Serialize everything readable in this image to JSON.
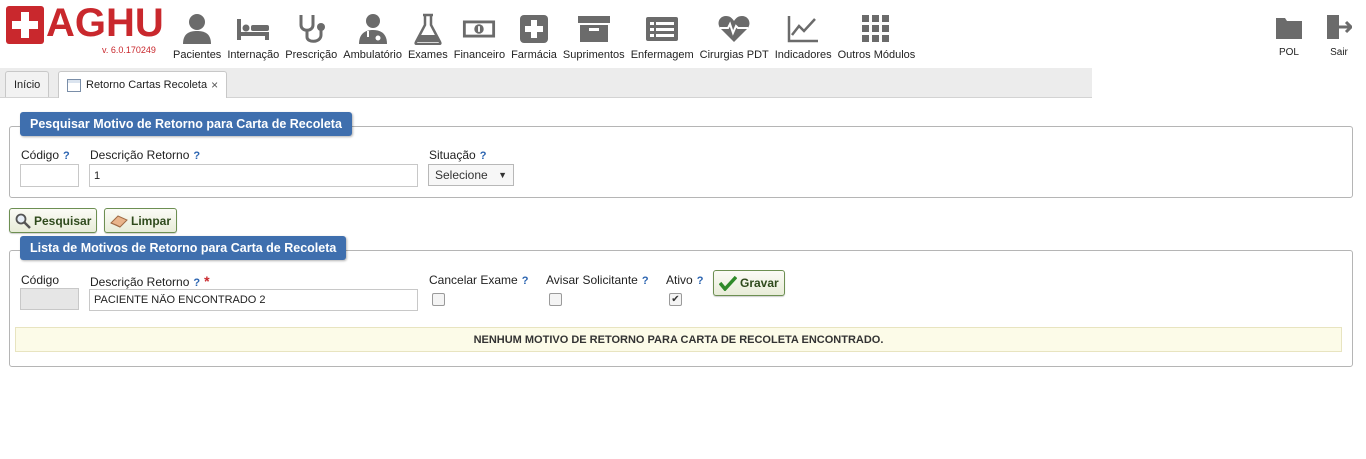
{
  "app": {
    "logo_text": "AGHU",
    "version": "v. 6.0.170249"
  },
  "nav": {
    "items": [
      {
        "label": "Pacientes",
        "icon": "user-icon"
      },
      {
        "label": "Internação",
        "icon": "bed-icon"
      },
      {
        "label": "Prescrição",
        "icon": "stethoscope-icon"
      },
      {
        "label": "Ambulatório",
        "icon": "doctor-icon"
      },
      {
        "label": "Exames",
        "icon": "flask-icon"
      },
      {
        "label": "Financeiro",
        "icon": "money-icon"
      },
      {
        "label": "Farmácia",
        "icon": "plus-box-icon"
      },
      {
        "label": "Suprimentos",
        "icon": "archive-icon"
      },
      {
        "label": "Enfermagem",
        "icon": "list-icon"
      },
      {
        "label": "Cirurgias PDT",
        "icon": "heartbeat-icon"
      },
      {
        "label": "Indicadores",
        "icon": "line-chart-icon"
      },
      {
        "label": "Outros Módulos",
        "icon": "grid-icon"
      }
    ],
    "pol_label": "POL",
    "exit_label": "Sair"
  },
  "tabs": [
    {
      "label": "Início"
    },
    {
      "label": "Retorno Cartas Recoleta",
      "close": "×"
    }
  ],
  "search_panel": {
    "title": "Pesquisar Motivo de Retorno para Carta de Recoleta",
    "codigo_label": "Código",
    "codigo_value": "",
    "descricao_label": "Descrição Retorno",
    "descricao_value": "1",
    "situacao_label": "Situação",
    "situacao_value": "Selecione",
    "help": "?"
  },
  "actions": {
    "search_label": "Pesquisar",
    "clear_label": "Limpar"
  },
  "list_panel": {
    "title": "Lista de Motivos de Retorno para Carta de Recoleta",
    "codigo_label": "Código",
    "codigo_value": "",
    "descricao_label": "Descrição Retorno",
    "required_mark": "*",
    "descricao_value": "PACIENTE NÃO ENCONTRADO 2",
    "cancelar_label": "Cancelar Exame",
    "cancelar_checked": false,
    "avisar_label": "Avisar Solicitante",
    "avisar_checked": false,
    "ativo_label": "Ativo",
    "ativo_checked": true,
    "check_mark": "✔",
    "save_label": "Gravar",
    "empty_message": "NENHUM MOTIVO DE RETORNO PARA CARTA DE RECOLETA ENCONTRADO.",
    "help": "?"
  },
  "colors": {
    "brand_red": "#c9282d",
    "panel_title_bg": "#3f6fae",
    "icon_gray": "#6b6b6b"
  }
}
